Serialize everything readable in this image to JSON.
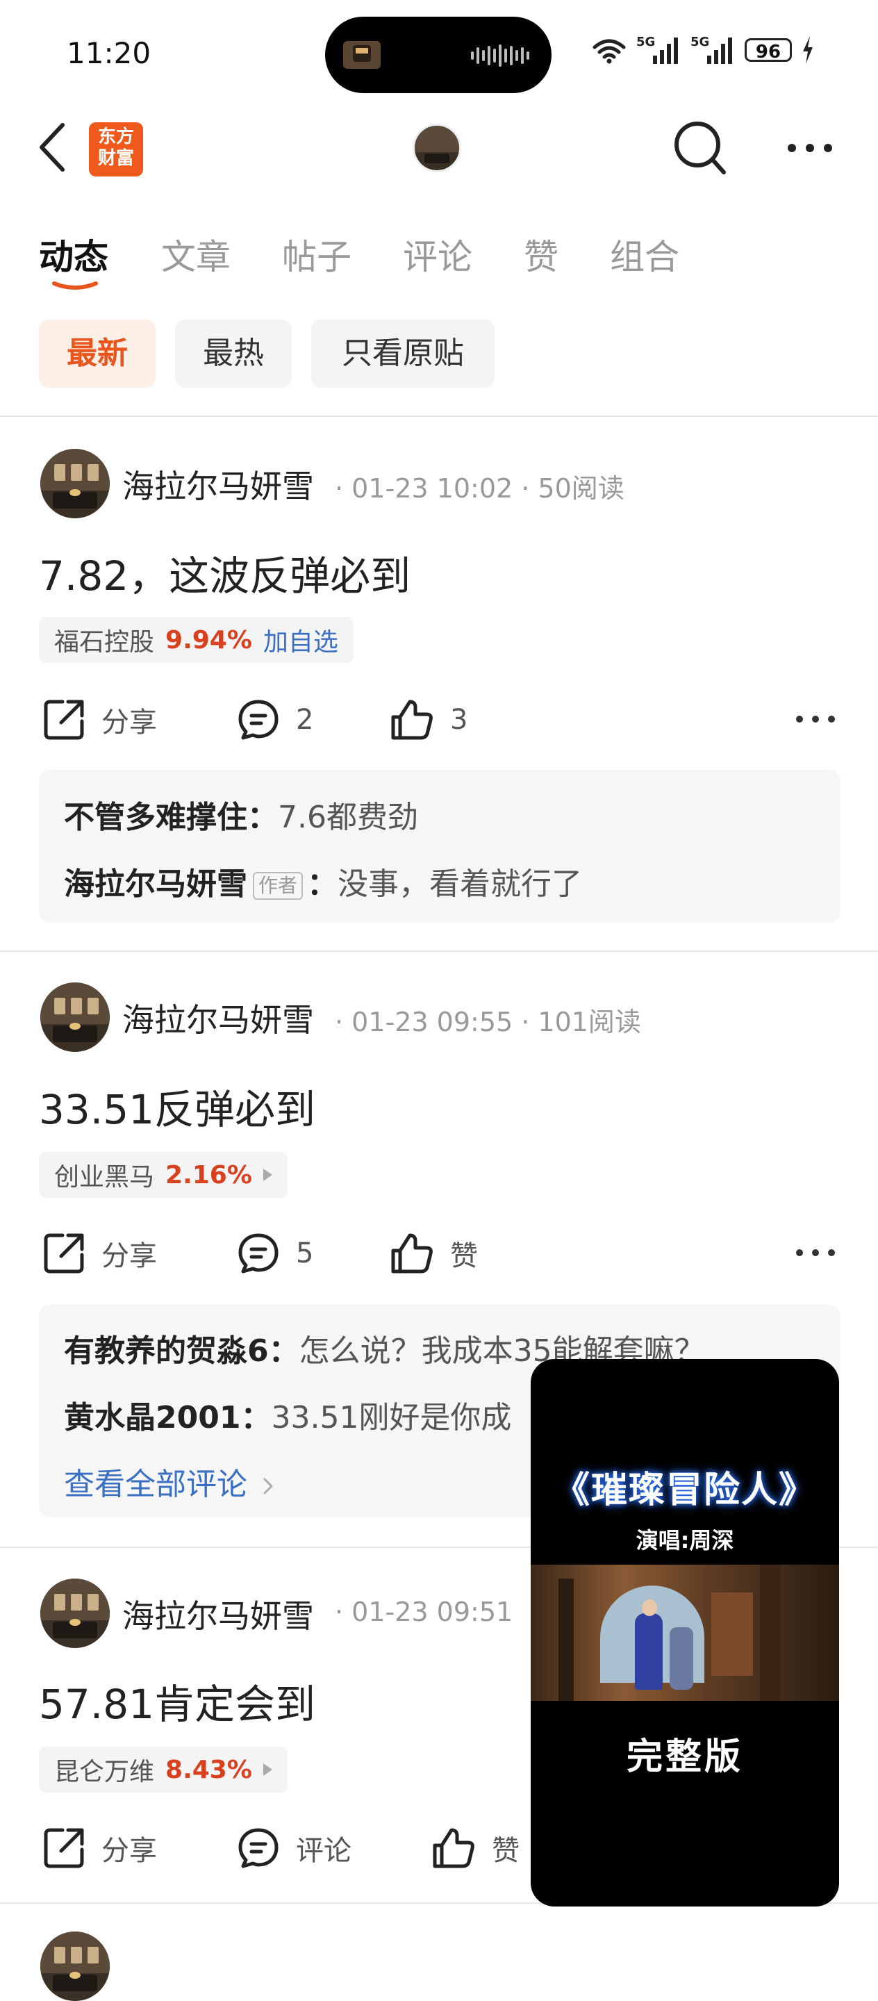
{
  "status_bar": {
    "time": "11:20",
    "battery": "96",
    "signal_labels": [
      "5G",
      "5G"
    ]
  },
  "nav": {
    "logo_text": [
      "东方",
      "财富"
    ]
  },
  "tabs": [
    "动态",
    "文章",
    "帖子",
    "评论",
    "赞",
    "组合"
  ],
  "filters": [
    "最新",
    "最热",
    "只看原贴"
  ],
  "posts": [
    {
      "author": "海拉尔马妍雪",
      "meta": "· 01-23 10:02 · 50阅读",
      "text": "7.82，这波反弹必到",
      "stock": {
        "name": "福石控股",
        "pct": "9.94%",
        "action": "加自选"
      },
      "share_label": "分享",
      "comment_count": "2",
      "like_count": "3",
      "comments": [
        {
          "name": "不管多难撑住",
          "sep": "：",
          "text": "7.6都费劲"
        },
        {
          "name": "海拉尔马妍雪",
          "tag": "作者",
          "sep": "：",
          "text": "没事，看着就行了"
        }
      ]
    },
    {
      "author": "海拉尔马妍雪",
      "meta": "· 01-23 09:55 · 101阅读",
      "text": "33.51反弹必到",
      "stock": {
        "name": "创业黑马",
        "pct": "2.16%"
      },
      "share_label": "分享",
      "comment_count": "5",
      "like_label": "赞",
      "comments": [
        {
          "name": "有教养的贺淼6",
          "sep": "：",
          "text": "怎么说？我成本35能解套嘛？"
        },
        {
          "name": "黄水晶2001",
          "sep": "：",
          "text": "33.51刚好是你成"
        }
      ],
      "view_all": "查看全部评论"
    },
    {
      "author": "海拉尔马妍雪",
      "meta": "· 01-23 09:51",
      "text": "57.81肯定会到",
      "stock": {
        "name": "昆仑万维",
        "pct": "8.43%"
      },
      "share_label": "分享",
      "comment_label": "评论",
      "like_label": "赞"
    }
  ],
  "video_overlay": {
    "title": "《璀璨冒险人》",
    "subtitle": "演唱:周深",
    "caption": "完整版"
  },
  "colors": {
    "accent": "#e8551d",
    "stock_up": "#d9401e",
    "link": "#3b6fc4",
    "logo_bg": "#ef5a1c"
  }
}
